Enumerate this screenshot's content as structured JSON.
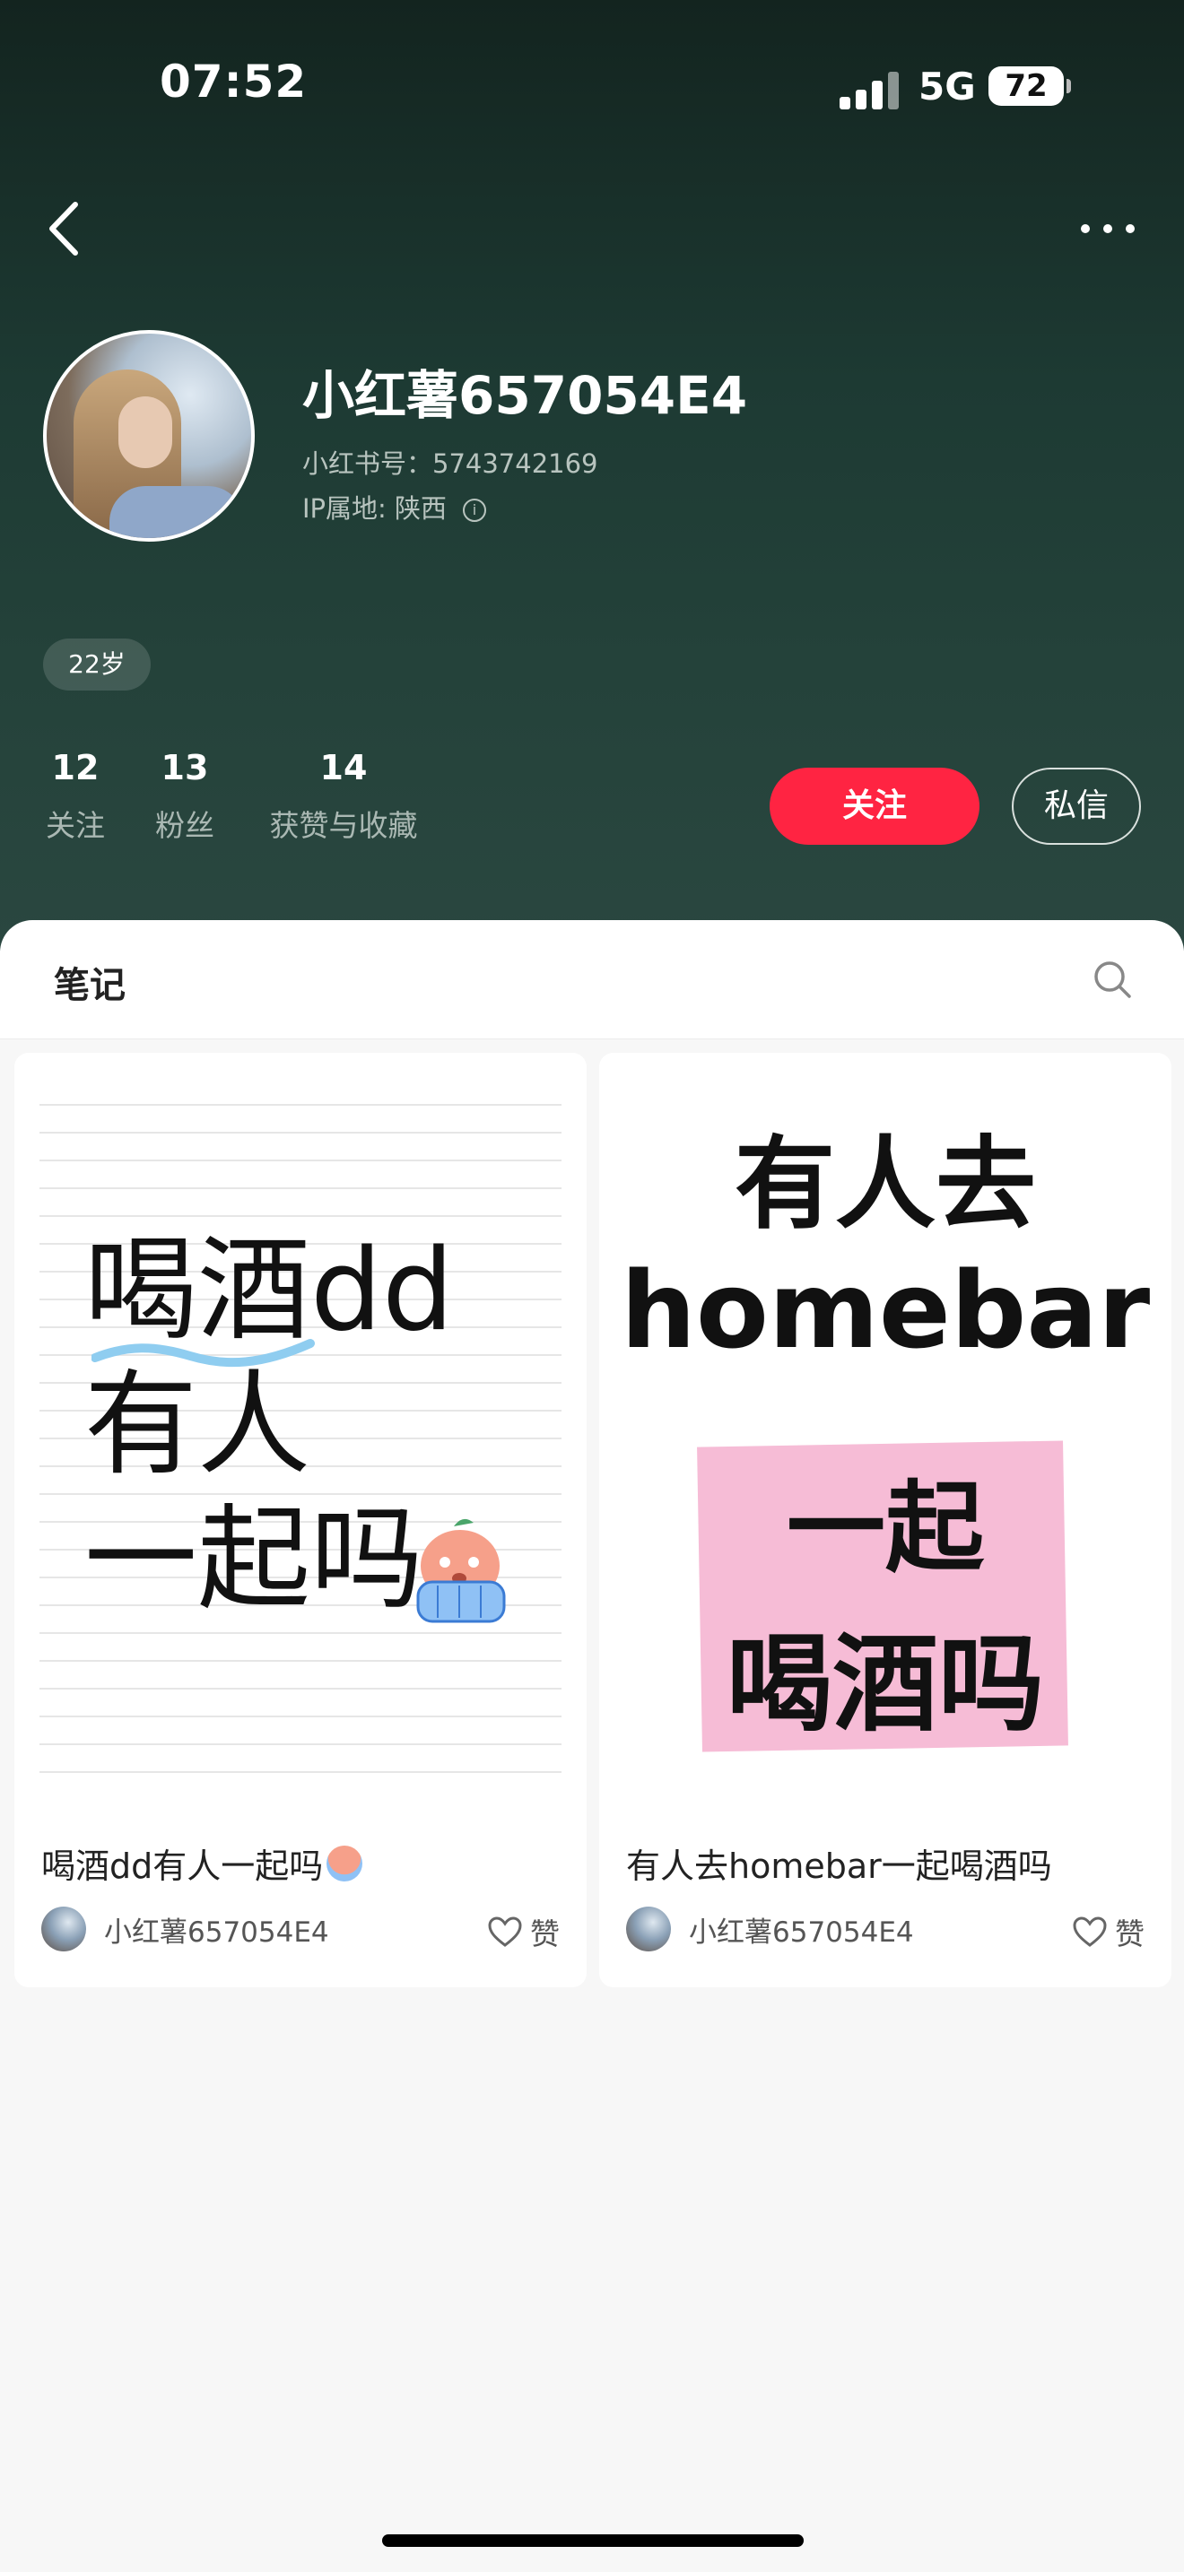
{
  "status_bar": {
    "time": "07:52",
    "network": "5G",
    "battery": "72"
  },
  "profile": {
    "name": "小红薯657054E4",
    "red_id": "小红书号：5743742169",
    "ip_location": "IP属地: 陕西",
    "age_tag": "22岁",
    "stats": [
      {
        "num": "12",
        "label": "关注"
      },
      {
        "num": "13",
        "label": "粉丝"
      },
      {
        "num": "14",
        "label": "获赞与收藏"
      }
    ],
    "follow_label": "关注",
    "message_label": "私信"
  },
  "tabs": {
    "notes_label": "笔记"
  },
  "notes": [
    {
      "cover_lines": [
        "喝酒dd",
        "有人",
        "一起吗"
      ],
      "title": "喝酒dd有人一起吗",
      "author": "小红薯657054E4",
      "like_label": "赞"
    },
    {
      "cover_lines": [
        "有人去",
        "homebar",
        "一起",
        "喝酒吗"
      ],
      "title": "有人去homebar一起喝酒吗",
      "author": "小红薯657054E4",
      "like_label": "赞"
    }
  ],
  "colors": {
    "accent": "#ff2442",
    "header_bg": "#1d3a33"
  }
}
